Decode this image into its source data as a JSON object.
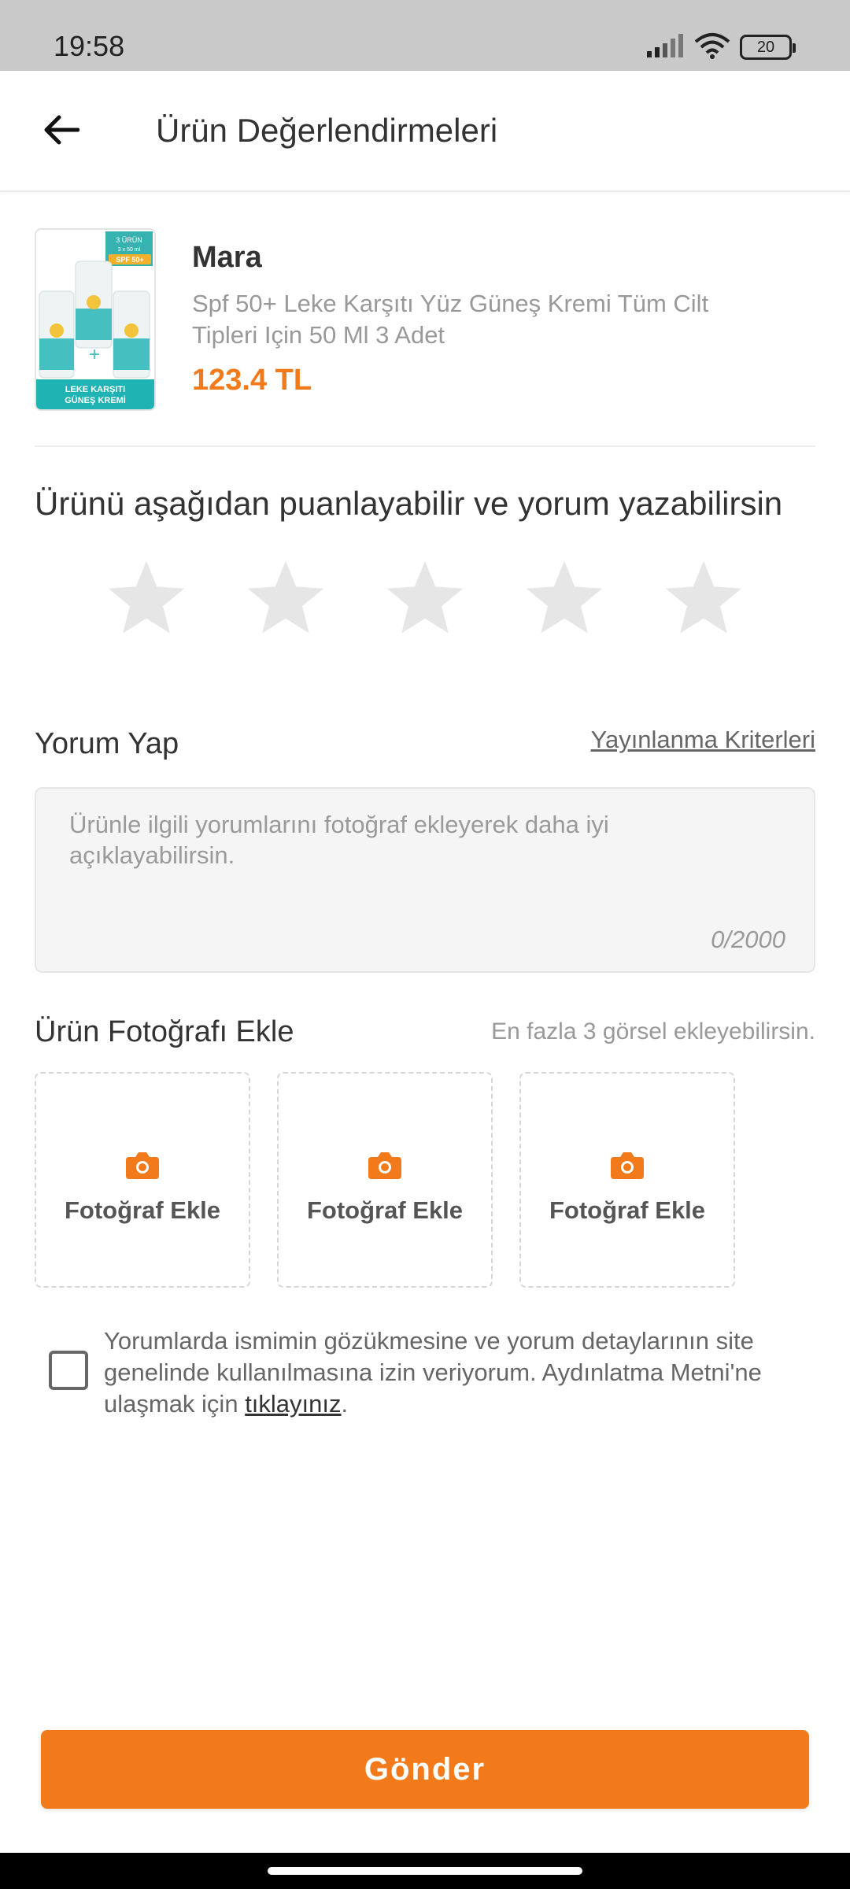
{
  "status_bar": {
    "time": "19:58",
    "battery_level": "20",
    "icons": [
      "signal-icon",
      "wifi-icon",
      "battery-icon"
    ]
  },
  "header": {
    "title": "Ürün Değerlendirmeleri",
    "back_icon": "arrow-left-icon"
  },
  "product": {
    "brand": "Mara",
    "name": "Spf 50+ Leke Karşıtı Yüz Güneş Kremi Tüm Cilt Tipleri Için 50 Ml 3 Adet",
    "price": "123.4 TL",
    "image_badge": "3 ÜRÜN",
    "image_badge_sub": "3 x 50 ml",
    "image_spf": "SPF 50+",
    "image_caption_1": "LEKE KARŞITI",
    "image_caption_2": "GÜNEŞ KREMİ"
  },
  "rating": {
    "title": "Ürünü aşağıdan puanlayabilir ve yorum yazabilirsin",
    "max_stars": 5,
    "selected": 0
  },
  "comment": {
    "label": "Yorum Yap",
    "criteria_link": "Yayınlanma Kriterleri",
    "placeholder": "Ürünle ilgili yorumlarını fotoğraf ekleyerek daha iyi açıklayabilirsin.",
    "counter": "0/2000"
  },
  "photos": {
    "label": "Ürün Fotoğrafı Ekle",
    "hint": "En fazla 3 görsel ekleyebilirsin.",
    "slots": [
      {
        "label": "Fotoğraf Ekle"
      },
      {
        "label": "Fotoğraf Ekle"
      },
      {
        "label": "Fotoğraf Ekle"
      }
    ]
  },
  "consent": {
    "checked": false,
    "text_before": "Yorumlarda ismimin gözükmesine ve yorum detaylarının site genelinde kullanılmasına izin veriyorum. Aydınlatma Metni'ne ulaşmak için ",
    "link": "tıklayınız",
    "text_after": "."
  },
  "submit": {
    "label": "Gönder"
  },
  "colors": {
    "accent": "#f27a1a",
    "star_empty": "#e6e6e6",
    "text_primary": "#333333",
    "text_secondary": "#999999"
  }
}
